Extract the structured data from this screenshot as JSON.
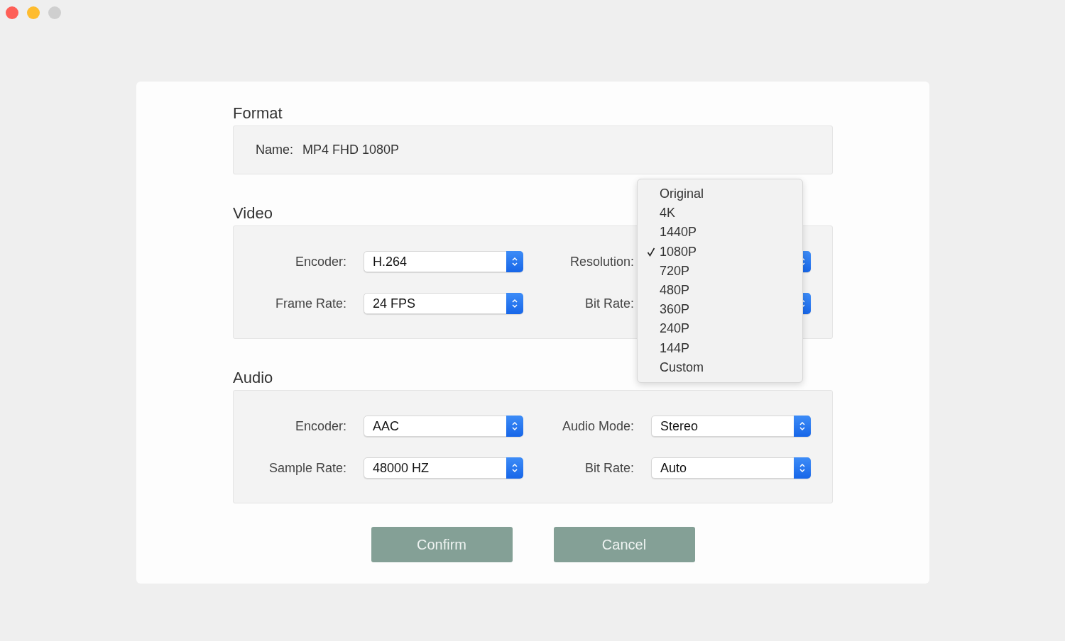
{
  "window_controls": [
    {
      "kind": "close"
    },
    {
      "kind": "minimize"
    },
    {
      "kind": "zoom"
    }
  ],
  "format": {
    "title": "Format",
    "name_label": "Name:",
    "name_value": "MP4 FHD 1080P"
  },
  "video": {
    "title": "Video",
    "fields": [
      {
        "label": "Encoder:",
        "value": "H.264"
      },
      {
        "label": "Resolution:"
      },
      {
        "label": "Frame Rate:",
        "value": "24 FPS"
      },
      {
        "label": "Bit Rate:"
      }
    ]
  },
  "audio": {
    "title": "Audio",
    "fields": [
      {
        "label": "Encoder:",
        "value": "AAC"
      },
      {
        "label": "Audio Mode:",
        "value": "Stereo"
      },
      {
        "label": "Sample Rate:",
        "value": "48000 HZ"
      },
      {
        "label": "Bit Rate:",
        "value": "Auto"
      }
    ]
  },
  "resolution_menu": {
    "items": [
      {
        "label": "Original",
        "selected": false
      },
      {
        "label": "4K",
        "selected": false
      },
      {
        "label": "1440P",
        "selected": false
      },
      {
        "label": "1080P",
        "selected": true
      },
      {
        "label": "720P",
        "selected": false
      },
      {
        "label": "480P",
        "selected": false
      },
      {
        "label": "360P",
        "selected": false
      },
      {
        "label": "240P",
        "selected": false
      },
      {
        "label": "144P",
        "selected": false
      },
      {
        "label": "Custom",
        "selected": false
      }
    ]
  },
  "buttons": [
    "Confirm",
    "Cancel"
  ]
}
